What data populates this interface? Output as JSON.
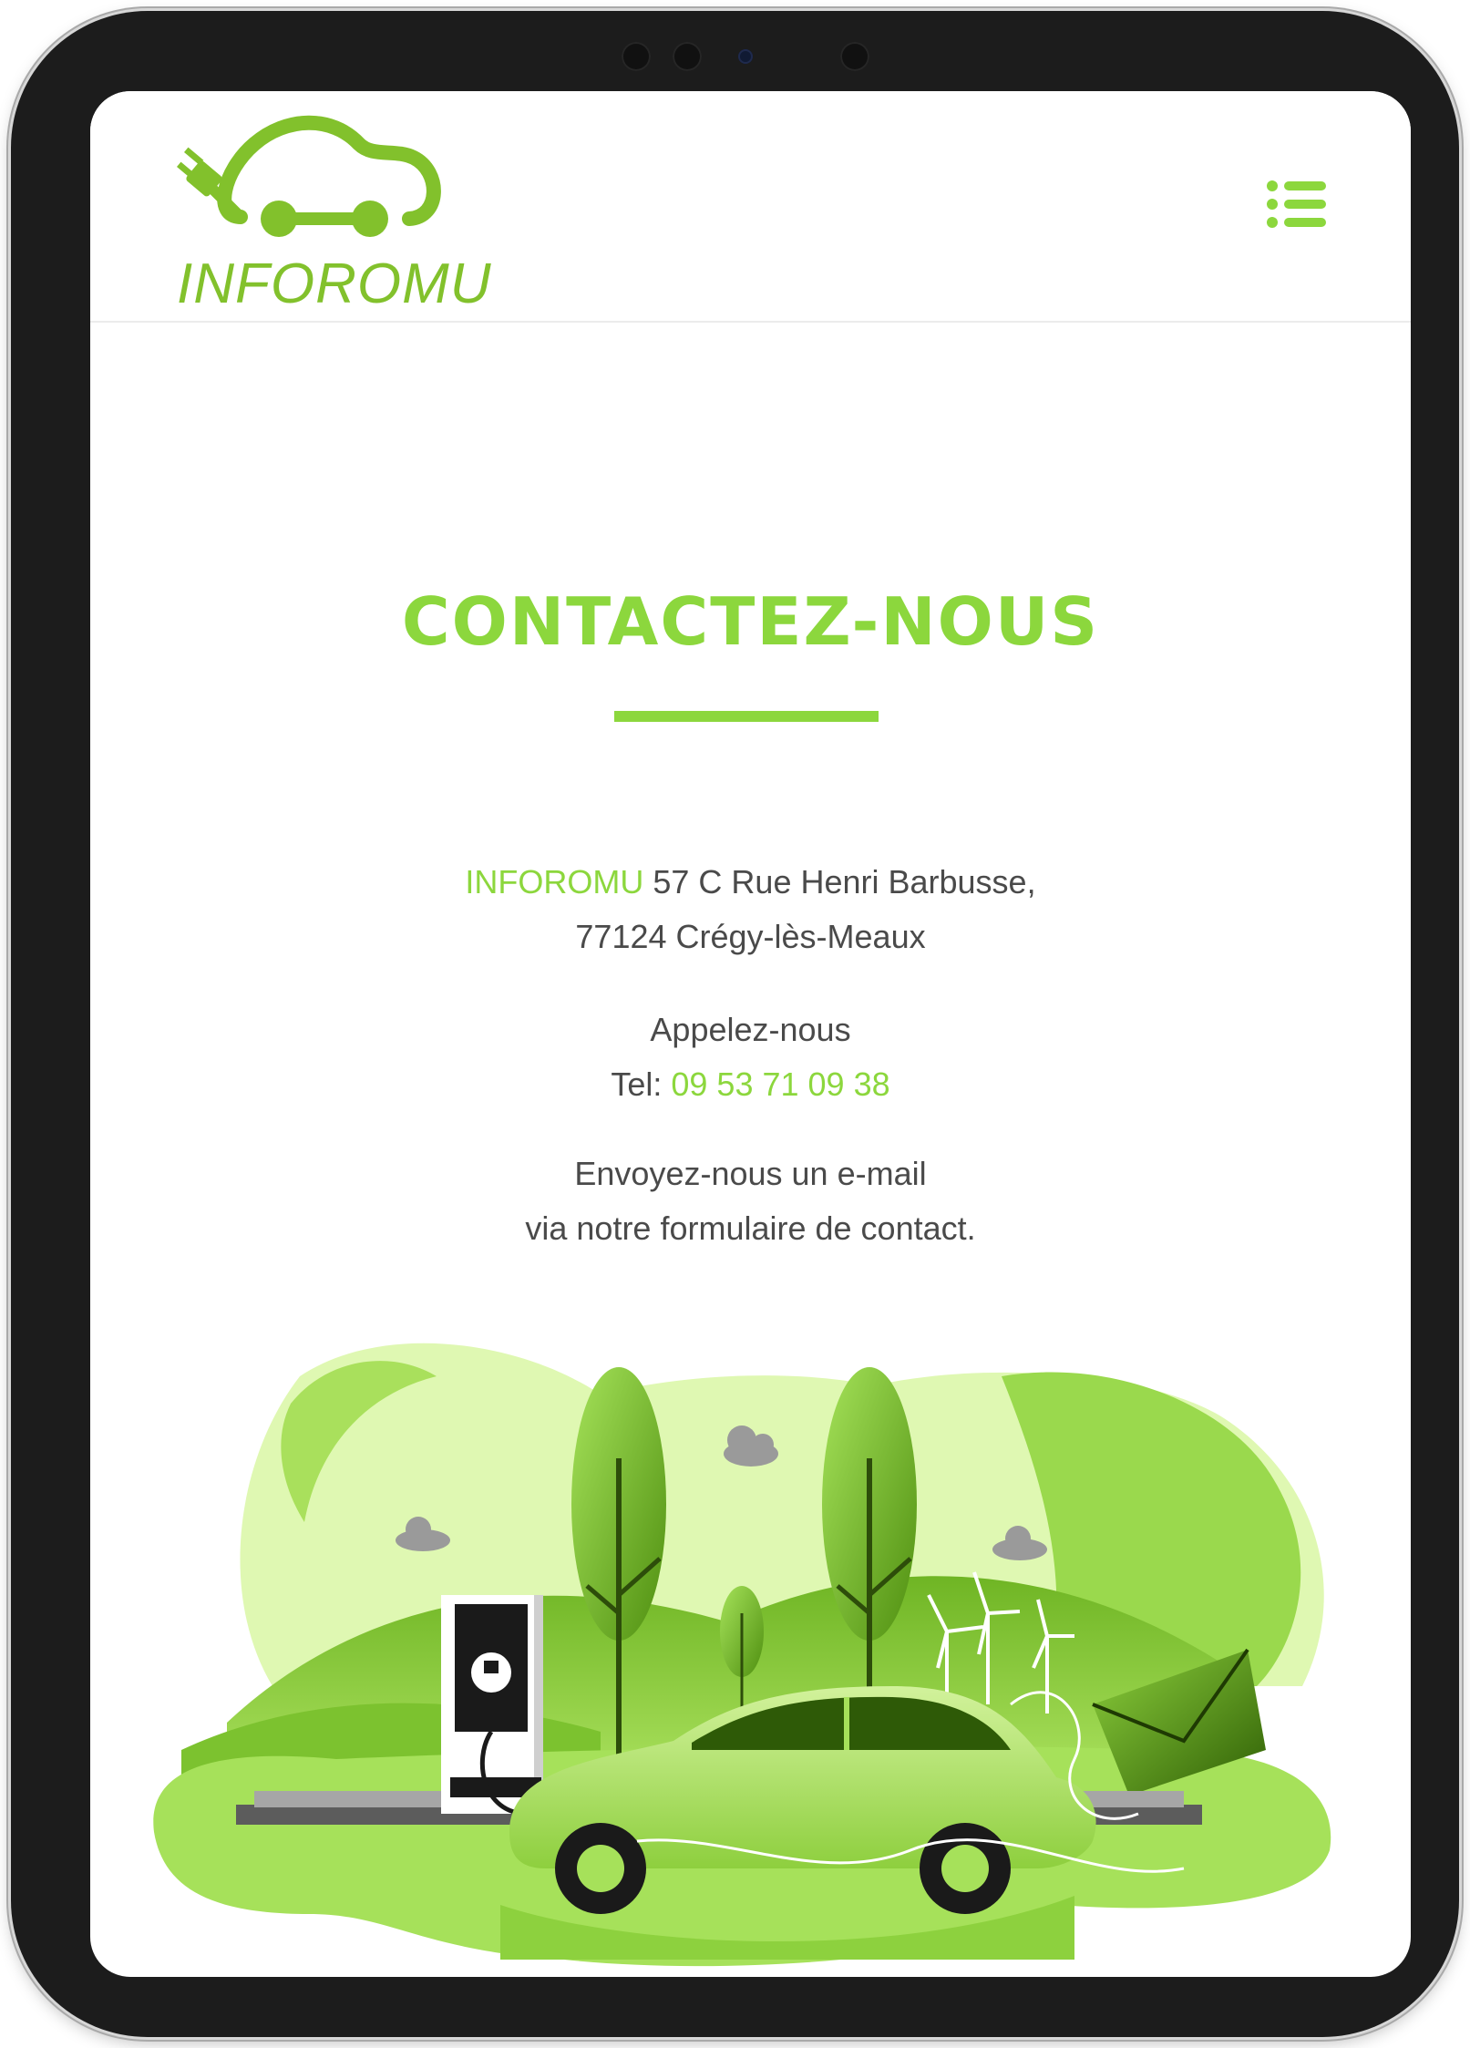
{
  "brand": {
    "name": "INFOROMU",
    "accent_color": "#8cd73d"
  },
  "header": {
    "menu_icon": "list-icon"
  },
  "contact": {
    "title": "CONTACTEZ-NOUS",
    "address": {
      "company": "INFOROMU",
      "line1": " 57 C Rue Henri Barbusse,",
      "line2": "77124 Crégy-lès-Meaux"
    },
    "phone": {
      "heading": "Appelez-nous",
      "label": "Tel: ",
      "number": "09 53 71 09 38"
    },
    "email": {
      "line1": "Envoyez-nous un e-mail",
      "line2": "via notre formulaire de contact."
    }
  },
  "illustration": {
    "icons": [
      "electric-car-icon",
      "charging-station-icon",
      "tree-icon",
      "wind-turbine-icon",
      "envelope-icon",
      "cloud-icon"
    ]
  }
}
